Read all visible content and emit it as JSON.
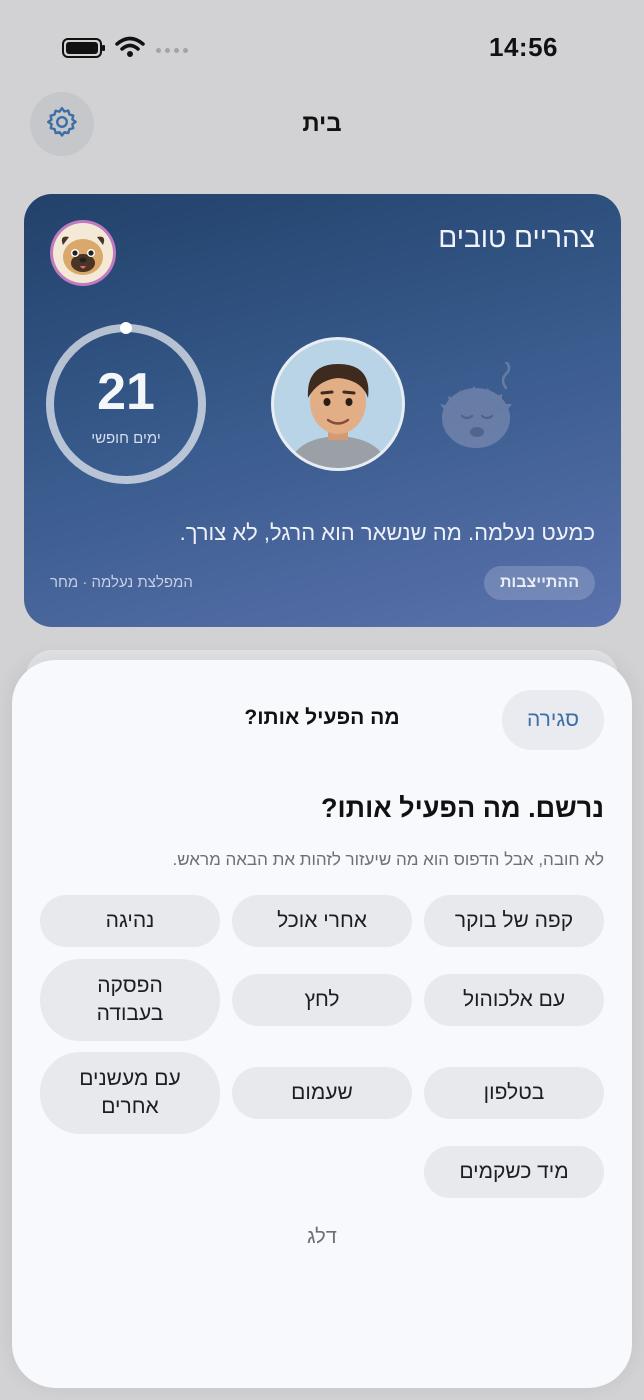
{
  "status_bar": {
    "time": "14:56"
  },
  "nav": {
    "title": "בית"
  },
  "hero": {
    "greeting": "צהריים טובים",
    "days_count": "21",
    "days_label": "ימים חופשי",
    "message": "כמעט נעלמה. מה שנשאר הוא הרגל, לא צורך.",
    "reset_label": "ההתייצבות",
    "footnote": "המפלצת נעלמה · מחר",
    "ring_progress": 1.0
  },
  "sheet": {
    "title": "מה הפעיל אותו?",
    "close_label": "סגירה",
    "heading": "נרשם. מה הפעיל אותו?",
    "subtitle": "לא חובה, אבל הדפוס הוא מה שיעזור לזהות את הבאה מראש.",
    "triggers": [
      {
        "label": "קפה של בוקר"
      },
      {
        "label": "אחרי אוכל"
      },
      {
        "label": "נהיגה"
      },
      {
        "label": "עם אלכוהול"
      },
      {
        "label": "לחץ"
      },
      {
        "label": "הפסקה בעבודה"
      },
      {
        "label": "בטלפון"
      },
      {
        "label": "שעמום"
      },
      {
        "label": "עם מעשנים אחרים"
      },
      {
        "label": "מיד כשקמים"
      }
    ],
    "skip_label": "דלג"
  },
  "colors": {
    "accent": "#3d6ea6",
    "hero_gradient_top": "#22416a",
    "hero_gradient_bottom": "#5a72ad"
  }
}
